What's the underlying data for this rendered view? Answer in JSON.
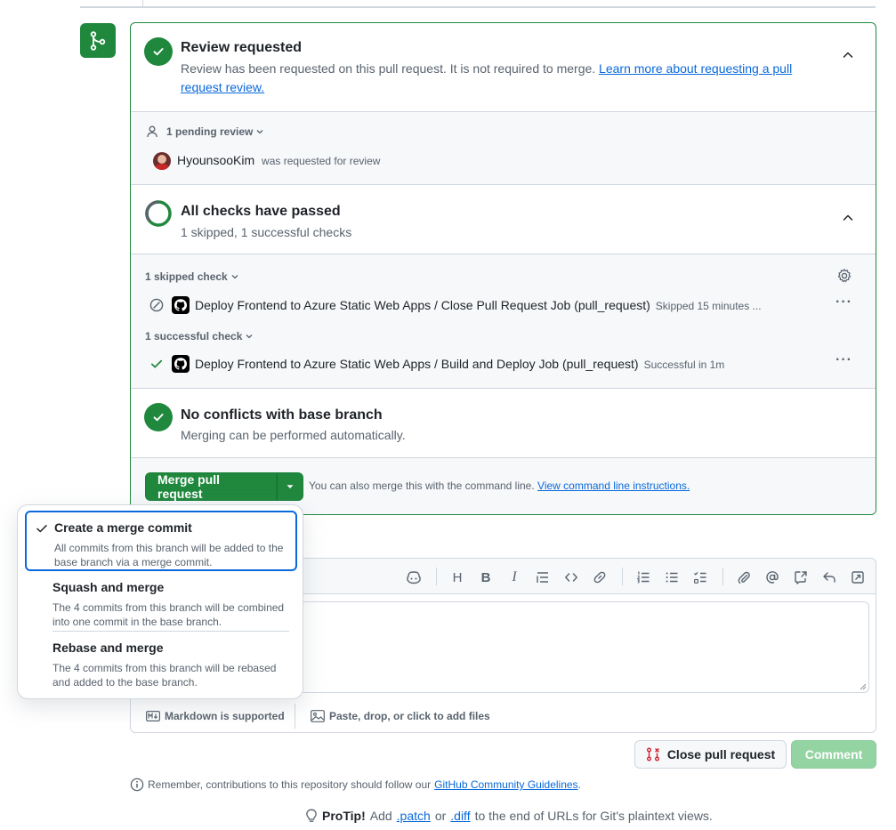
{
  "review": {
    "title": "Review requested",
    "subtitle": "Review has been requested on this pull request. It is not required to merge.",
    "link": "Learn more about requesting a pull request review.",
    "pending_label": "1 pending review",
    "reviewer_name": "HyounsooKim",
    "reviewer_status": "was requested for review"
  },
  "checks": {
    "title": "All checks have passed",
    "subtitle": "1 skipped, 1 successful checks",
    "skipped_label": "1 skipped check",
    "skipped_item": "Deploy Frontend to Azure Static Web Apps / Close Pull Request Job (pull_request)",
    "skipped_meta": "Skipped 15 minutes ...",
    "successful_label": "1 successful check",
    "successful_item": "Deploy Frontend to Azure Static Web Apps / Build and Deploy Job (pull_request)",
    "successful_meta": "Successful in 1m",
    "more": "···"
  },
  "conflicts": {
    "title": "No conflicts with base branch",
    "subtitle": "Merging can be performed automatically."
  },
  "merge": {
    "button": "Merge pull request",
    "note": "You can also merge this with the command line.",
    "note_link": "View command line instructions."
  },
  "menu": {
    "items": [
      {
        "title": "Create a merge commit",
        "desc": "All commits from this branch will be added to the base branch via a merge commit."
      },
      {
        "title": "Squash and merge",
        "desc": "The 4 commits from this branch will be combined into one commit in the base branch."
      },
      {
        "title": "Rebase and merge",
        "desc": "The 4 commits from this branch will be rebased and added to the base branch."
      }
    ]
  },
  "editor": {
    "markdown": "Markdown is supported",
    "attach": "Paste, drop, or click to add files",
    "toolbar": {
      "heading": "H",
      "bold": "B",
      "italic": "I"
    }
  },
  "actions": {
    "close": "Close pull request",
    "comment": "Comment"
  },
  "footer": {
    "remember": "Remember, contributions to this repository should follow our",
    "guidelines": "GitHub Community Guidelines",
    "period": ".",
    "protip_label": "ProTip!",
    "protip_add": "Add",
    "patch": ".patch",
    "or": "or",
    "diff": ".diff",
    "protip_rest": "to the end of URLs for Git's plaintext views."
  },
  "colors": {
    "success": "#1f883d",
    "accent": "#0969da",
    "border": "#d0d7de",
    "danger": "#cf222e"
  }
}
